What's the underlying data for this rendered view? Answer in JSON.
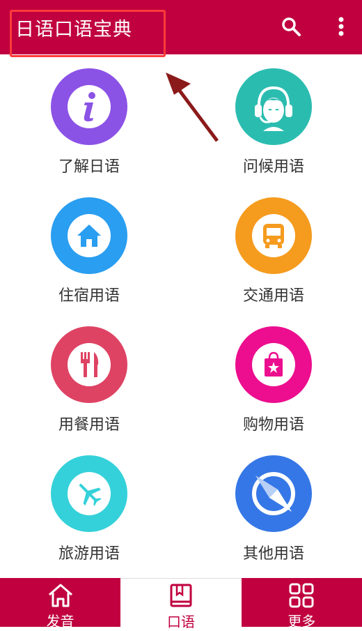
{
  "header": {
    "title": "日语口语宝典"
  },
  "tiles": [
    {
      "label": "了解日语",
      "color": "#8b52e6",
      "icon": "info-icon"
    },
    {
      "label": "问候用语",
      "color": "#2bbcb0",
      "icon": "headset-girl-icon"
    },
    {
      "label": "住宿用语",
      "color": "#2a9ef0",
      "icon": "house-icon"
    },
    {
      "label": "交通用语",
      "color": "#f59b1e",
      "icon": "bus-icon"
    },
    {
      "label": "用餐用语",
      "color": "#de4364",
      "icon": "fork-knife-icon"
    },
    {
      "label": "购物用语",
      "color": "#ec0e8e",
      "icon": "shopping-bag-icon"
    },
    {
      "label": "旅游用语",
      "color": "#35d1da",
      "icon": "airplane-icon"
    },
    {
      "label": "其他用语",
      "color": "#3577e6",
      "icon": "compass-icon"
    }
  ],
  "bottom_nav": [
    {
      "label": "发音",
      "icon": "home-icon",
      "active": false
    },
    {
      "label": "口语",
      "icon": "book-icon",
      "active": true
    },
    {
      "label": "更多",
      "icon": "grid-icon",
      "active": false
    }
  ],
  "colors": {
    "brand": "#c0003f",
    "annotation": "#ff3b3b",
    "arrow": "#8b1a1a"
  }
}
